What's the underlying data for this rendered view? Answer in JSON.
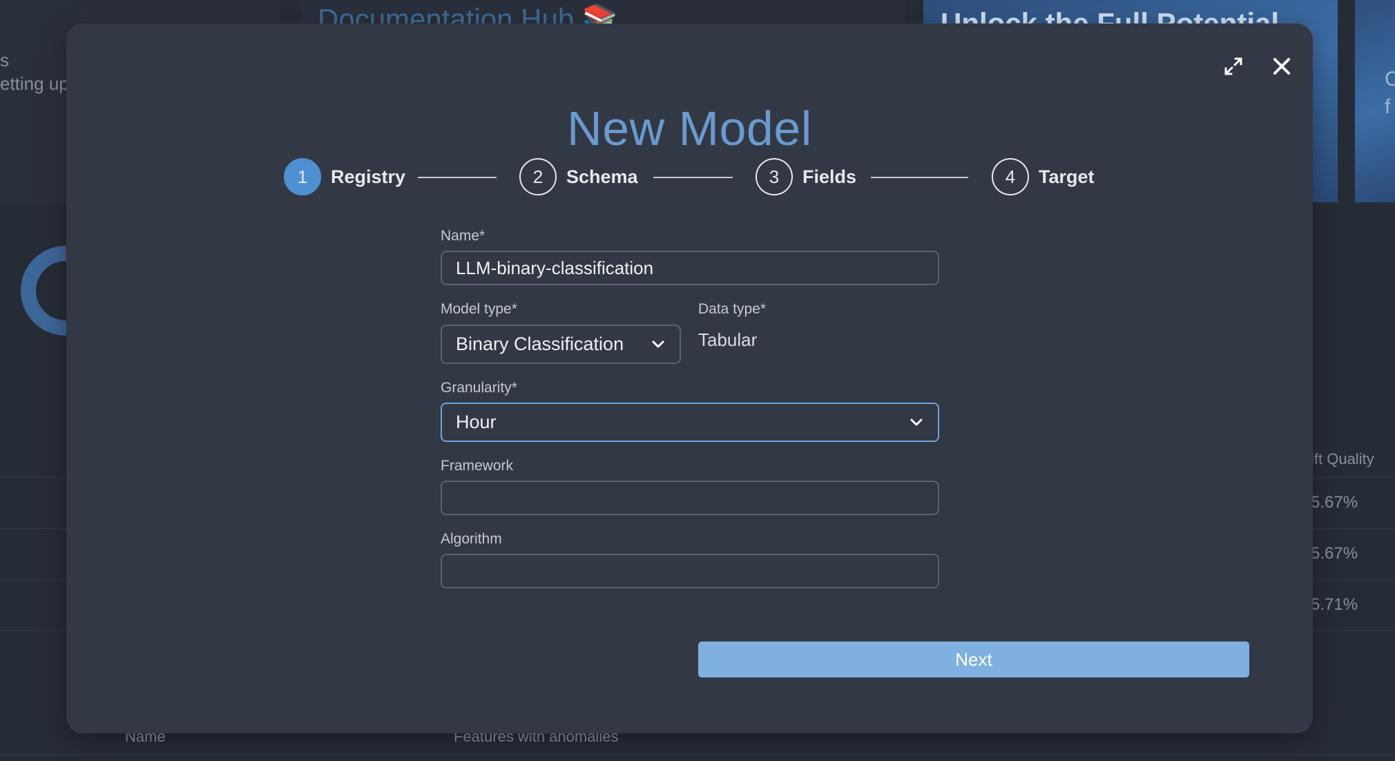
{
  "background": {
    "doc_heading": "Documentation Hub 📚",
    "banner_heading": "Unlock the Full Potential",
    "left_snippet_1": "s",
    "left_snippet_2": "etting up",
    "right_snippet_1": "C",
    "right_snippet_2": "f",
    "table_header_partial": "ift Quality",
    "table_values": [
      "5.67%",
      "5.67%",
      "5.71%"
    ],
    "bottom_col_name": "Name",
    "bottom_col_features": "Features with anomalies"
  },
  "modal": {
    "title": "New Model",
    "expand_icon": "expand-arrows-icon",
    "close_icon": "close-x-icon",
    "steps": [
      {
        "number": "1",
        "label": "Registry",
        "active": true
      },
      {
        "number": "2",
        "label": "Schema",
        "active": false
      },
      {
        "number": "3",
        "label": "Fields",
        "active": false
      },
      {
        "number": "4",
        "label": "Target",
        "active": false
      }
    ],
    "form": {
      "name_label": "Name*",
      "name_value": "LLM-binary-classification",
      "model_type_label": "Model type*",
      "model_type_value": "Binary Classification",
      "data_type_label": "Data type*",
      "data_type_value": "Tabular",
      "granularity_label": "Granularity*",
      "granularity_value": "Hour",
      "framework_label": "Framework",
      "framework_value": "",
      "algorithm_label": "Algorithm",
      "algorithm_value": ""
    },
    "next_label": "Next"
  },
  "colors": {
    "accent": "#4f8fd4",
    "title": "#6a9ad0",
    "next_button": "#7fb0e0",
    "modal_bg": "#323944"
  }
}
